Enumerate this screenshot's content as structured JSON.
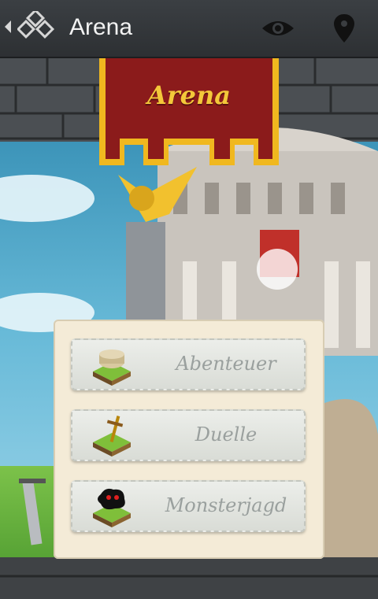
{
  "actionbar": {
    "title": "Arena"
  },
  "banner": {
    "title": "Arena"
  },
  "menu": {
    "items": [
      {
        "label": "Abenteuer",
        "icon": "colosseum-icon"
      },
      {
        "label": "Duelle",
        "icon": "sword-icon"
      },
      {
        "label": "Monsterjagd",
        "icon": "monster-icon"
      }
    ]
  },
  "colors": {
    "actionbar": "#2d3033",
    "banner_red": "#8b1b1b",
    "banner_gold": "#f3c83a",
    "panel": "#f4ebd7",
    "label": "#9aa09e"
  }
}
